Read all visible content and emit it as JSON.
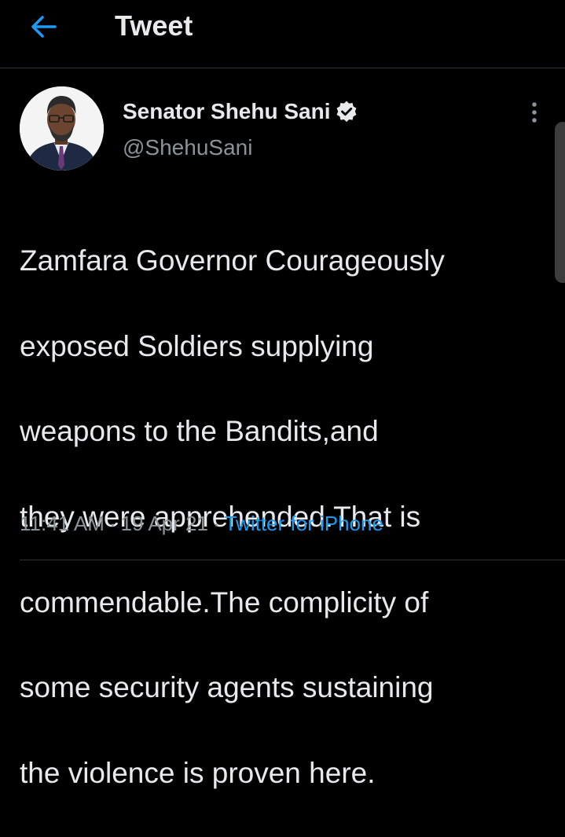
{
  "header": {
    "title": "Tweet",
    "back_icon": "arrow-left-icon",
    "accent_color": "#1d9bf0"
  },
  "tweet": {
    "author_name": "Senator Shehu Sani",
    "verified": true,
    "handle": "@ShehuSani",
    "text_lines": [
      "Zamfara Governor Courageously",
      "exposed Soldiers supplying",
      "weapons to the Bandits,and",
      "they were apprehended.That is",
      "commendable.The complicity of",
      "some security agents sustaining",
      "the violence is proven here."
    ],
    "time": "11:41 AM",
    "date": "19 Apr 21",
    "separator": "·",
    "source": "Twitter for iPhone"
  }
}
